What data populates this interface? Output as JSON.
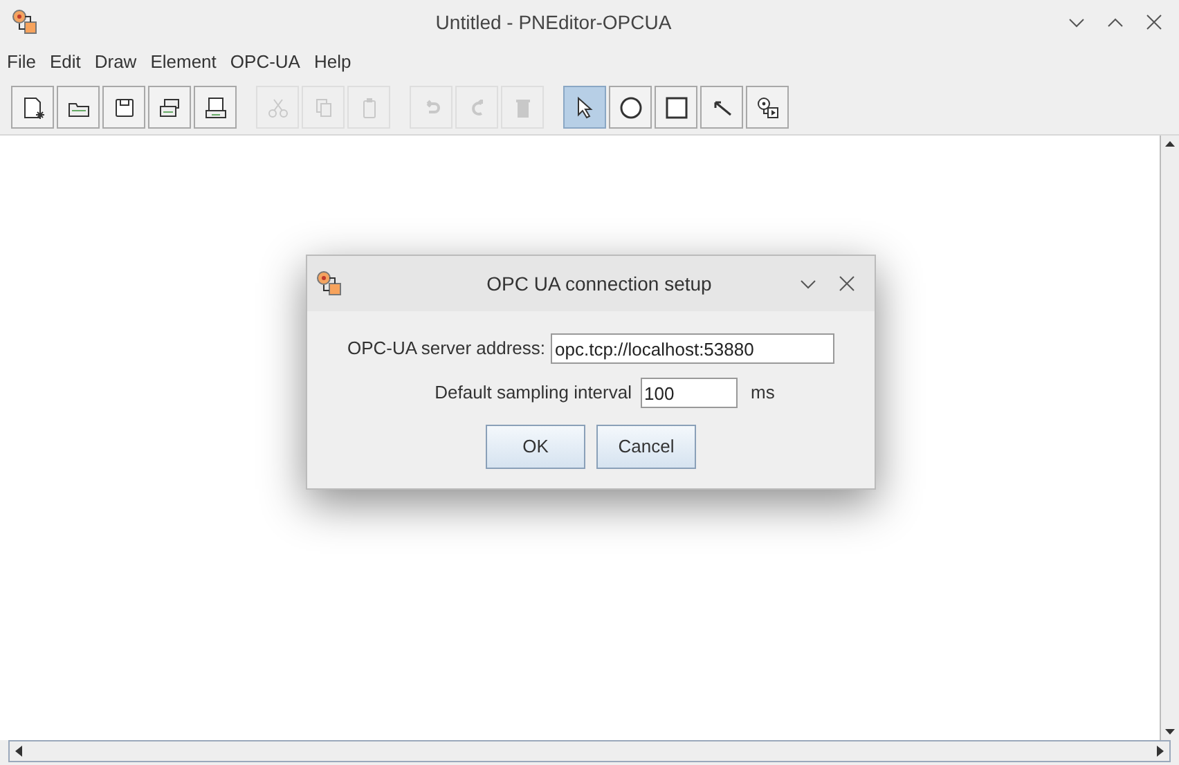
{
  "window": {
    "title": "Untitled - PNEditor-OPCUA"
  },
  "menu": [
    "File",
    "Edit",
    "Draw",
    "Element",
    "OPC-UA",
    "Help"
  ],
  "toolbar": [
    [
      {
        "kind": "new",
        "disabled": false,
        "selected": false
      },
      {
        "kind": "open",
        "disabled": false,
        "selected": false
      },
      {
        "kind": "save",
        "disabled": false,
        "selected": false
      },
      {
        "kind": "import",
        "disabled": false,
        "selected": false
      },
      {
        "kind": "export",
        "disabled": false,
        "selected": false
      }
    ],
    [
      {
        "kind": "cut",
        "disabled": true,
        "selected": false
      },
      {
        "kind": "copy",
        "disabled": true,
        "selected": false
      },
      {
        "kind": "paste",
        "disabled": true,
        "selected": false
      }
    ],
    [
      {
        "kind": "undo",
        "disabled": true,
        "selected": false
      },
      {
        "kind": "redo",
        "disabled": true,
        "selected": false
      },
      {
        "kind": "delete",
        "disabled": true,
        "selected": false
      }
    ],
    [
      {
        "kind": "select",
        "disabled": false,
        "selected": true
      },
      {
        "kind": "place",
        "disabled": false,
        "selected": false
      },
      {
        "kind": "transition",
        "disabled": false,
        "selected": false
      },
      {
        "kind": "arc",
        "disabled": false,
        "selected": false
      },
      {
        "kind": "token",
        "disabled": false,
        "selected": false
      }
    ]
  ],
  "dialog": {
    "title": "OPC UA connection setup",
    "server_label": "OPC-UA server address:",
    "server_value": "opc.tcp://localhost:53880",
    "interval_label": "Default sampling interval",
    "interval_value": "100",
    "interval_unit": "ms",
    "buttons": [
      "OK",
      "Cancel"
    ]
  }
}
